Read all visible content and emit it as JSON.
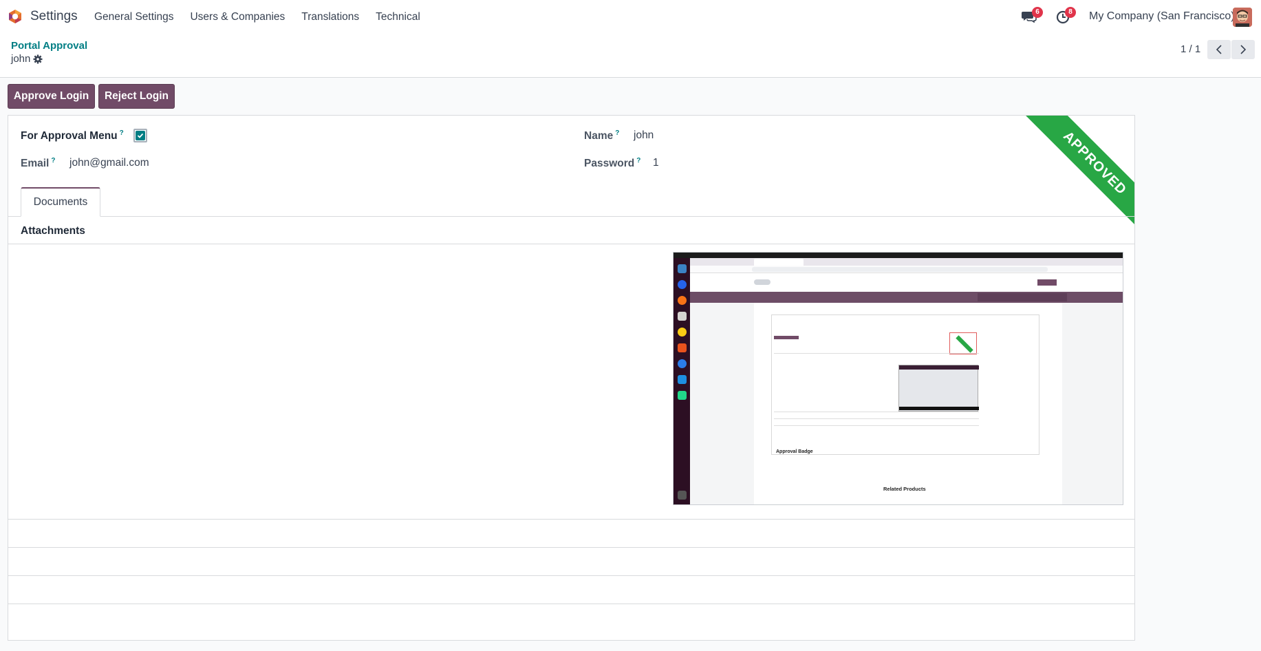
{
  "navbar": {
    "app_name": "Settings",
    "menu": [
      "General Settings",
      "Users & Companies",
      "Translations",
      "Technical"
    ],
    "messages_count": "6",
    "activities_count": "8",
    "company": "My Company (San Francisco)"
  },
  "control_panel": {
    "breadcrumb": "Portal Approval",
    "record_name": "john",
    "pager": "1 / 1"
  },
  "buttons": {
    "approve": "Approve Login",
    "reject": "Reject Login"
  },
  "form": {
    "approval_menu_label": "For Approval Menu",
    "approval_menu_checked": true,
    "email_label": "Email",
    "email_value": "john@gmail.com",
    "name_label": "Name",
    "name_value": "john",
    "password_label": "Password",
    "password_value": "1",
    "tooltip_mark": "?",
    "ribbon": "APPROVED",
    "ribbon_color": "#28a745"
  },
  "tabs": [
    "Documents"
  ],
  "attachments": {
    "title": "Attachments",
    "screenshot": {
      "approval_badge": "Approval Badge",
      "related_products": "Related Products"
    }
  },
  "colors": {
    "primary": "#714b67",
    "accent": "#017e84",
    "badge": "#e0344a"
  }
}
